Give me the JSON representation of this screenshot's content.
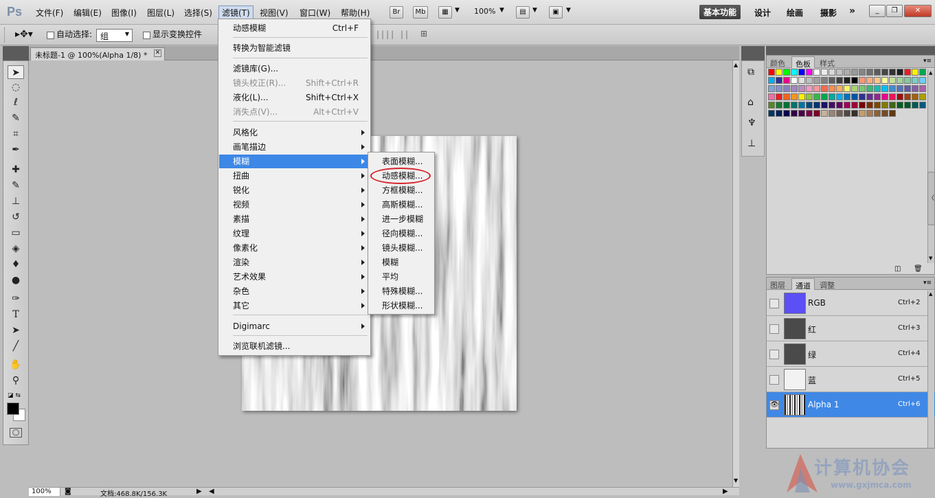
{
  "app": {
    "logo": "Ps",
    "title": "未标题-1 @ 100%(Alpha 1/8) *"
  },
  "menubar": {
    "items": [
      "文件(F)",
      "编辑(E)",
      "图像(I)",
      "图层(L)",
      "选择(S)",
      "滤镜(T)",
      "视图(V)",
      "窗口(W)",
      "帮助(H)"
    ],
    "bridge": "Br",
    "minibridge": "Mb",
    "zoom": "100%",
    "workspaces": [
      "基本功能",
      "设计",
      "绘画",
      "摄影"
    ],
    "more": "»"
  },
  "options": {
    "auto_select_label": "自动选择:",
    "auto_select_value": "组",
    "show_transform_label": "显示变换控件"
  },
  "filter_menu": {
    "items": [
      {
        "label": "动感模糊",
        "shortcut": "Ctrl+F",
        "disabled": false
      },
      {
        "label": "转换为智能滤镜",
        "shortcut": "",
        "disabled": false
      },
      {
        "label": "滤镜库(G)...",
        "shortcut": "",
        "disabled": false
      },
      {
        "label": "镜头校正(R)...",
        "shortcut": "Shift+Ctrl+R",
        "disabled": true
      },
      {
        "label": "液化(L)...",
        "shortcut": "Shift+Ctrl+X",
        "disabled": false
      },
      {
        "label": "消失点(V)...",
        "shortcut": "Alt+Ctrl+V",
        "disabled": true
      },
      {
        "label": "风格化",
        "sub": true
      },
      {
        "label": "画笔描边",
        "sub": true
      },
      {
        "label": "模糊",
        "sub": true,
        "highlighted": true
      },
      {
        "label": "扭曲",
        "sub": true
      },
      {
        "label": "锐化",
        "sub": true
      },
      {
        "label": "视频",
        "sub": true
      },
      {
        "label": "素描",
        "sub": true
      },
      {
        "label": "纹理",
        "sub": true
      },
      {
        "label": "像素化",
        "sub": true
      },
      {
        "label": "渲染",
        "sub": true
      },
      {
        "label": "艺术效果",
        "sub": true
      },
      {
        "label": "杂色",
        "sub": true
      },
      {
        "label": "其它",
        "sub": true
      },
      {
        "label": "Digimarc",
        "sub": true
      },
      {
        "label": "浏览联机滤镜...",
        "shortcut": ""
      }
    ]
  },
  "blur_submenu": {
    "items": [
      "表面模糊...",
      "动感模糊...",
      "方框模糊...",
      "高斯模糊...",
      "进一步模糊",
      "径向模糊...",
      "镜头模糊...",
      "模糊",
      "平均",
      "特殊模糊...",
      "形状模糊..."
    ],
    "circled": "动感模糊..."
  },
  "swatches_panel": {
    "tabs": [
      "颜色",
      "色板",
      "样式"
    ],
    "active_tab": "色板",
    "rows": [
      [
        "#ff0000",
        "#ffff00",
        "#00ff00",
        "#00ffff",
        "#0000ff",
        "#ff00ff",
        "#ffffff",
        "#ebebeb",
        "#d6d6d6",
        "#c2c2c2",
        "#adadad",
        "#999999",
        "#858585",
        "#707070",
        "#5c5c5c",
        "#474747",
        "#333333",
        "#1f1f1f",
        "#ed1c24",
        "#fff200",
        "#00a651"
      ],
      [
        "#00aeef",
        "#2e3192",
        "#ec008c",
        "#ffffff",
        "#e0e0e0",
        "#c0c0c0",
        "#a0a0a0",
        "#808080",
        "#606060",
        "#404040",
        "#202020",
        "#000000",
        "#f7977a",
        "#f9ad81",
        "#fdc68a",
        "#fff79a",
        "#c4df9b",
        "#a2d39c",
        "#82ca9d",
        "#7bcdc8",
        "#6ecff6"
      ],
      [
        "#7ea7d8",
        "#8493ca",
        "#8882be",
        "#a187be",
        "#bc8dbf",
        "#f49ac2",
        "#f6989d",
        "#f26c4f",
        "#f68e55",
        "#fbaf5c",
        "#fff467",
        "#acd372",
        "#7cc576",
        "#3bb878",
        "#1abbb4",
        "#00bff3",
        "#438ccb",
        "#5574b9",
        "#605ca8",
        "#855fa8",
        "#a763a8"
      ],
      [
        "#f06ea9",
        "#ed1c24",
        "#f26522",
        "#f7941d",
        "#fff200",
        "#8dc63f",
        "#39b54a",
        "#00a651",
        "#00a99d",
        "#00aeef",
        "#0072bc",
        "#0054a6",
        "#2e3192",
        "#662d91",
        "#92278f",
        "#ec008c",
        "#ed145b",
        "#9e0b0f",
        "#a0410d",
        "#a3620a",
        "#aba000"
      ],
      [
        "#598527",
        "#1a7b30",
        "#007236",
        "#00746b",
        "#0076a3",
        "#004a80",
        "#003471",
        "#1b1464",
        "#440e62",
        "#630460",
        "#9e005d",
        "#9e0039",
        "#790000",
        "#7b2e00",
        "#7d4900",
        "#827b00",
        "#406618",
        "#005e20",
        "#005826",
        "#005952",
        "#005b7f"
      ],
      [
        "#003663",
        "#002157",
        "#0d004c",
        "#32004b",
        "#4b0049",
        "#7b0046",
        "#7a0026",
        "#c7b299",
        "#998675",
        "#736357",
        "#534741",
        "#37302a",
        "#c69c6d",
        "#a67c52",
        "#8c6239",
        "#754c24",
        "#603913"
      ]
    ]
  },
  "channels_panel": {
    "tabs": [
      "图层",
      "通道",
      "调整"
    ],
    "active_tab": "通道",
    "rows": [
      {
        "name": "RGB",
        "shortcut": "Ctrl+2",
        "thumb": "#5b4ff5",
        "visible": false,
        "selected": false
      },
      {
        "name": "红",
        "shortcut": "Ctrl+3",
        "thumb": "#4a4a4a",
        "visible": false,
        "selected": false
      },
      {
        "name": "绿",
        "shortcut": "Ctrl+4",
        "thumb": "#4a4a4a",
        "visible": false,
        "selected": false
      },
      {
        "name": "蓝",
        "shortcut": "Ctrl+5",
        "thumb": "#f2f2f2",
        "visible": false,
        "selected": false
      },
      {
        "name": "Alpha 1",
        "shortcut": "Ctrl+6",
        "thumb": "noise",
        "visible": true,
        "selected": true
      }
    ]
  },
  "status": {
    "zoom": "100%",
    "doc": "文档:468.8K/156.3K"
  },
  "watermark": {
    "title": "计算机协会",
    "url": "www.gxjmca.com"
  },
  "colors": {
    "menu_highlight": "#3d87e6",
    "circle": "#d6232a",
    "selected_row": "#3f88e6"
  }
}
